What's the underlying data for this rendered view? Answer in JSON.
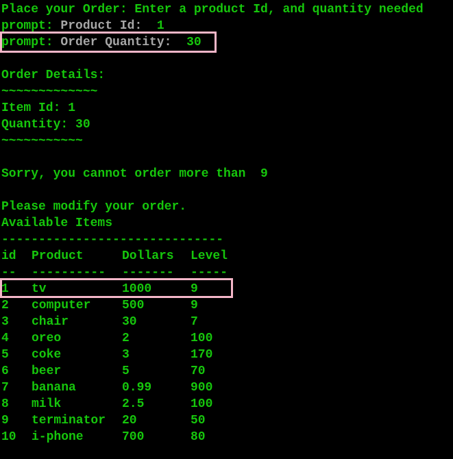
{
  "colors": {
    "background": "#000000",
    "text_green": "#16c60c",
    "text_gray": "#a6a6a6",
    "highlight_pink": "#f4b6c8"
  },
  "intro": "Place your Order: Enter a product Id, and quantity needed",
  "prompt_product": {
    "prefix": "prompt:",
    "label": " Product Id: ",
    "value": " 1"
  },
  "prompt_quantity": {
    "prefix": "prompt:",
    "label": " Order Quantity: ",
    "value": " 30"
  },
  "order_details": {
    "heading": "Order Details:",
    "separator_top": "~~~~~~~~~~~~~",
    "item_id": "Item Id: 1",
    "quantity": "Quantity: 30",
    "separator_bottom": "~~~~~~~~~~~"
  },
  "error_message": "Sorry, you cannot order more than  9",
  "modify_message": "Please modify your order.",
  "available_heading": "Available Items",
  "table_rule": "------------------------------",
  "table": {
    "headers": [
      "id",
      "Product",
      "Dollars",
      "Level"
    ],
    "underline": [
      "--",
      "----------",
      "-------",
      "-----"
    ],
    "rows": [
      [
        "1",
        "tv",
        "1000",
        "9"
      ],
      [
        "2",
        "computer",
        "500",
        "9"
      ],
      [
        "3",
        "chair",
        "30",
        "7"
      ],
      [
        "4",
        "oreo",
        "2",
        "100"
      ],
      [
        "5",
        "coke",
        "3",
        "170"
      ],
      [
        "6",
        "beer",
        "5",
        "70"
      ],
      [
        "7",
        "banana",
        "0.99",
        "900"
      ],
      [
        "8",
        "milk",
        "2.5",
        "100"
      ],
      [
        "9",
        "terminator",
        "20",
        "50"
      ],
      [
        "10",
        "i-phone",
        "700",
        "80"
      ]
    ]
  }
}
